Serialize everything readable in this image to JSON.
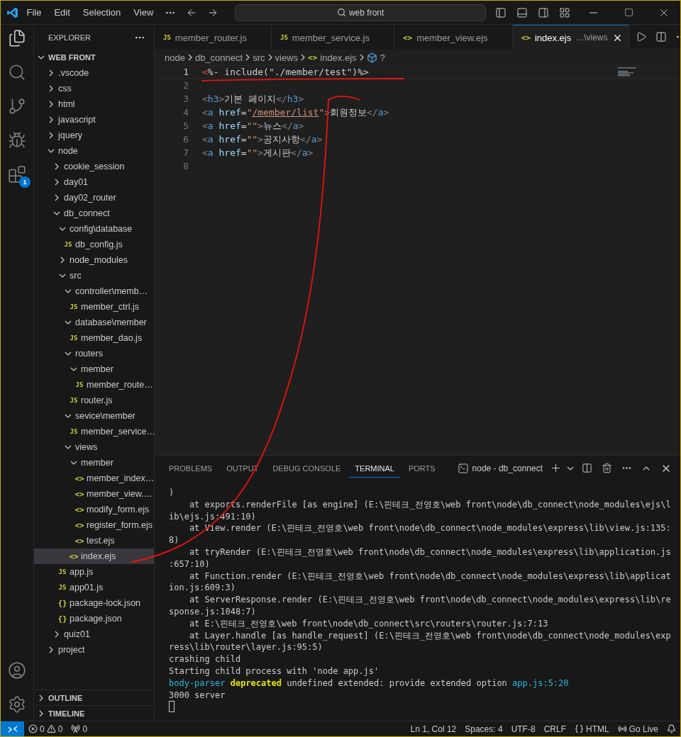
{
  "title_bar": {
    "menu": [
      "File",
      "Edit",
      "Selection",
      "View"
    ],
    "search": "web front"
  },
  "activity_bar": {
    "extensions_badge": "1"
  },
  "sidebar": {
    "title": "EXPLORER",
    "root": {
      "label": "WEB FRONT",
      "expanded": true
    },
    "tree": [
      {
        "label": ".vscode",
        "kind": "folder",
        "expanded": false,
        "selected": false
      },
      {
        "label": "css",
        "kind": "folder",
        "expanded": false,
        "selected": false
      },
      {
        "label": "html",
        "kind": "folder",
        "expanded": false,
        "selected": false
      },
      {
        "label": "javascript",
        "kind": "folder",
        "expanded": false,
        "selected": false
      },
      {
        "label": "jquery",
        "kind": "folder",
        "expanded": false,
        "selected": false
      },
      {
        "label": "node",
        "kind": "folder",
        "expanded": true,
        "selected": false,
        "children": [
          {
            "label": "cookie_session",
            "kind": "folder",
            "expanded": false,
            "selected": false
          },
          {
            "label": "day01",
            "kind": "folder",
            "expanded": false,
            "selected": false
          },
          {
            "label": "day02_router",
            "kind": "folder",
            "expanded": false,
            "selected": false
          },
          {
            "label": "db_connect",
            "kind": "folder",
            "expanded": true,
            "selected": false,
            "children": [
              {
                "label": "config\\database",
                "kind": "folder",
                "expanded": true,
                "selected": false,
                "children": [
                  {
                    "label": "db_config.js",
                    "kind": "file",
                    "icon": "JS",
                    "selected": false
                  }
                ]
              },
              {
                "label": "node_modules",
                "kind": "folder",
                "expanded": false,
                "selected": false
              },
              {
                "label": "src",
                "kind": "folder",
                "expanded": true,
                "selected": false,
                "children": [
                  {
                    "label": "controller\\memb…",
                    "kind": "folder",
                    "expanded": true,
                    "selected": false,
                    "children": [
                      {
                        "label": "member_ctrl.js",
                        "kind": "file",
                        "icon": "JS",
                        "selected": false
                      }
                    ]
                  },
                  {
                    "label": "database\\member",
                    "kind": "folder",
                    "expanded": true,
                    "selected": false,
                    "children": [
                      {
                        "label": "member_dao.js",
                        "kind": "file",
                        "icon": "JS",
                        "selected": false
                      }
                    ]
                  },
                  {
                    "label": "routers",
                    "kind": "folder",
                    "expanded": true,
                    "selected": false,
                    "children": [
                      {
                        "label": "member",
                        "kind": "folder",
                        "expanded": true,
                        "selected": false,
                        "children": [
                          {
                            "label": "member_route…",
                            "kind": "file",
                            "icon": "JS",
                            "selected": false
                          }
                        ]
                      },
                      {
                        "label": "router.js",
                        "kind": "file",
                        "icon": "JS",
                        "selected": false
                      }
                    ]
                  },
                  {
                    "label": "sevice\\member",
                    "kind": "folder",
                    "expanded": true,
                    "selected": false,
                    "children": [
                      {
                        "label": "member_service…",
                        "kind": "file",
                        "icon": "JS",
                        "selected": false
                      }
                    ]
                  },
                  {
                    "label": "views",
                    "kind": "folder",
                    "expanded": true,
                    "selected": false,
                    "children": [
                      {
                        "label": "member",
                        "kind": "folder",
                        "expanded": true,
                        "selected": false,
                        "children": [
                          {
                            "label": "member_index…",
                            "kind": "file",
                            "icon": "<>",
                            "selected": false
                          },
                          {
                            "label": "member_view.…",
                            "kind": "file",
                            "icon": "<>",
                            "selected": false
                          },
                          {
                            "label": "modify_form.ejs",
                            "kind": "file",
                            "icon": "<>",
                            "selected": false
                          },
                          {
                            "label": "register_form.ejs",
                            "kind": "file",
                            "icon": "<>",
                            "selected": false
                          },
                          {
                            "label": "test.ejs",
                            "kind": "file",
                            "icon": "<>",
                            "selected": false
                          }
                        ]
                      },
                      {
                        "label": "index.ejs",
                        "kind": "file",
                        "icon": "<>",
                        "selected": true
                      }
                    ]
                  }
                ]
              },
              {
                "label": "app.js",
                "kind": "file",
                "icon": "JS",
                "selected": false
              },
              {
                "label": "app01.js",
                "kind": "file",
                "icon": "JS",
                "selected": false
              },
              {
                "label": "package-lock.json",
                "kind": "file",
                "icon": "{}",
                "selected": false
              },
              {
                "label": "package.json",
                "kind": "file",
                "icon": "{}",
                "selected": false
              }
            ]
          },
          {
            "label": "quiz01",
            "kind": "folder",
            "expanded": false,
            "selected": false
          }
        ]
      },
      {
        "label": "project",
        "kind": "folder",
        "expanded": false,
        "selected": false
      }
    ],
    "sections": [
      {
        "label": "OUTLINE",
        "expanded": false
      },
      {
        "label": "TIMELINE",
        "expanded": false
      }
    ]
  },
  "tabs": [
    {
      "icon": "JS",
      "label": "member_router.js",
      "selected": false
    },
    {
      "icon": "JS",
      "label": "member_service.js",
      "selected": false
    },
    {
      "icon": "<>",
      "label": "member_view.ejs",
      "selected": false
    },
    {
      "icon": "<>",
      "label": "index.ejs",
      "description": "…\\views",
      "selected": true
    }
  ],
  "breadcrumbs": [
    {
      "kind": "folder",
      "label": "node"
    },
    {
      "kind": "folder",
      "label": "db_connect"
    },
    {
      "kind": "folder",
      "label": "src"
    },
    {
      "kind": "folder",
      "label": "views"
    },
    {
      "kind": "file",
      "icon": "<>",
      "label": "index.ejs"
    },
    {
      "kind": "symbol",
      "label": "?"
    }
  ],
  "editor": {
    "lines": [
      {
        "number": "1",
        "current": true,
        "tokens": [
          {
            "kind": "error",
            "text": "<"
          },
          {
            "kind": "text",
            "text": "%- include(\"./member/test\")%>"
          }
        ]
      },
      {
        "number": "2",
        "current": false
      },
      {
        "number": "3",
        "current": false,
        "tokens": [
          {
            "kind": "bracket",
            "text": "<"
          },
          {
            "kind": "tag",
            "text": "h3"
          },
          {
            "kind": "bracket",
            "text": ">"
          },
          {
            "kind": "text",
            "text": "기본 페이지"
          },
          {
            "kind": "bracket",
            "text": "</"
          },
          {
            "kind": "tag",
            "text": "h3"
          },
          {
            "kind": "bracket",
            "text": ">"
          }
        ]
      },
      {
        "number": "4",
        "current": false,
        "tokens": [
          {
            "kind": "bracket",
            "text": "<"
          },
          {
            "kind": "tag",
            "text": "a"
          },
          {
            "kind": "attr",
            "text": " href"
          },
          {
            "kind": "text",
            "text": "="
          },
          {
            "kind": "string",
            "text": "\""
          },
          {
            "kind": "link",
            "text": "/member/list"
          },
          {
            "kind": "string",
            "text": "\""
          },
          {
            "kind": "bracket",
            "text": ">"
          },
          {
            "kind": "text",
            "text": "회원정보"
          },
          {
            "kind": "bracket",
            "text": "</"
          },
          {
            "kind": "tag",
            "text": "a"
          },
          {
            "kind": "bracket",
            "text": ">"
          }
        ]
      },
      {
        "number": "5",
        "current": false,
        "tokens": [
          {
            "kind": "bracket",
            "text": "<"
          },
          {
            "kind": "tag",
            "text": "a"
          },
          {
            "kind": "attr",
            "text": " href"
          },
          {
            "kind": "text",
            "text": "="
          },
          {
            "kind": "string",
            "text": "\"\""
          },
          {
            "kind": "bracket",
            "text": ">"
          },
          {
            "kind": "text",
            "text": "뉴스"
          },
          {
            "kind": "bracket",
            "text": "</"
          },
          {
            "kind": "tag",
            "text": "a"
          },
          {
            "kind": "bracket",
            "text": ">"
          }
        ]
      },
      {
        "number": "6",
        "current": false,
        "tokens": [
          {
            "kind": "bracket",
            "text": "<"
          },
          {
            "kind": "tag",
            "text": "a"
          },
          {
            "kind": "attr",
            "text": " href"
          },
          {
            "kind": "text",
            "text": "="
          },
          {
            "kind": "string",
            "text": "\"\""
          },
          {
            "kind": "bracket",
            "text": ">"
          },
          {
            "kind": "text",
            "text": "공지사항"
          },
          {
            "kind": "bracket",
            "text": "</"
          },
          {
            "kind": "tag",
            "text": "a"
          },
          {
            "kind": "bracket",
            "text": ">"
          }
        ]
      },
      {
        "number": "7",
        "current": false,
        "tokens": [
          {
            "kind": "bracket",
            "text": "<"
          },
          {
            "kind": "tag",
            "text": "a"
          },
          {
            "kind": "attr",
            "text": " href"
          },
          {
            "kind": "text",
            "text": "="
          },
          {
            "kind": "string",
            "text": "\"\""
          },
          {
            "kind": "bracket",
            "text": ">"
          },
          {
            "kind": "text",
            "text": "게시판"
          },
          {
            "kind": "bracket",
            "text": "</"
          },
          {
            "kind": "tag",
            "text": "a"
          },
          {
            "kind": "bracket",
            "text": ">"
          }
        ]
      },
      {
        "number": "8",
        "current": false
      }
    ]
  },
  "panel": {
    "tabs": [
      {
        "label": "PROBLEMS",
        "selected": false
      },
      {
        "label": "OUTPUT",
        "selected": false
      },
      {
        "label": "DEBUG CONSOLE",
        "selected": false
      },
      {
        "label": "TERMINAL",
        "selected": true
      },
      {
        "label": "PORTS",
        "selected": false
      }
    ],
    "terminal_name": "node - db_connect",
    "lines": [
      {
        "kind": "plain",
        "text": ")"
      },
      {
        "kind": "plain",
        "text": "    at exports.renderFile [as engine] (E:\\핀테크_전영호\\web front\\node\\db_connect\\node_modules\\ejs\\l"
      },
      {
        "kind": "plain",
        "text": "ib\\ejs.js:491:10)"
      },
      {
        "kind": "plain",
        "text": "    at View.render (E:\\핀테크_전영호\\web front\\node\\db_connect\\node_modules\\express\\lib\\view.js:135:"
      },
      {
        "kind": "plain",
        "text": "8)"
      },
      {
        "kind": "plain",
        "text": "    at tryRender (E:\\핀테크_전영호\\web front\\node\\db_connect\\node_modules\\express\\lib\\application.js"
      },
      {
        "kind": "plain",
        "text": ":657:10)"
      },
      {
        "kind": "plain",
        "text": "    at Function.render (E:\\핀테크_전영호\\web front\\node\\db_connect\\node_modules\\express\\lib\\applicat"
      },
      {
        "kind": "plain",
        "text": "ion.js:609:3)"
      },
      {
        "kind": "plain",
        "text": "    at ServerResponse.render (E:\\핀테크_전영호\\web front\\node\\db_connect\\node_modules\\express\\lib\\re"
      },
      {
        "kind": "plain",
        "text": "sponse.js:1048:7)"
      },
      {
        "kind": "plain",
        "text": "    at E:\\핀테크_전영호\\web front\\node\\db_connect\\src\\routers\\router.js:7:13"
      },
      {
        "kind": "plain",
        "text": "    at Layer.handle [as handle_request] (E:\\핀테크_전영호\\web front\\node\\db_connect\\node_modules\\exp"
      },
      {
        "kind": "plain",
        "text": "ress\\lib\\router\\layer.js:95:5)"
      },
      {
        "kind": "plain",
        "text": "crashing child"
      },
      {
        "kind": "plain",
        "text": "Starting child process with 'node app.js'"
      },
      {
        "kind": "parts",
        "parts": [
          {
            "kind": "module",
            "text": "body-parser "
          },
          {
            "kind": "warning",
            "text": "deprecated"
          },
          {
            "kind": "plain",
            "text": " undefined extended: provide extended option"
          },
          {
            "kind": "location",
            "text": " app.js:5:20"
          }
        ]
      },
      {
        "kind": "plain",
        "text": "3000 server"
      }
    ]
  },
  "status_bar": {
    "errors": "0",
    "warnings": "0",
    "ports": "0",
    "right": [
      {
        "kind": "text",
        "label": "Ln 1, Col 12"
      },
      {
        "kind": "text",
        "label": "Spaces: 4"
      },
      {
        "kind": "text",
        "label": "UTF-8"
      },
      {
        "kind": "text",
        "label": "CRLF"
      },
      {
        "kind": "language",
        "label": "HTML"
      },
      {
        "kind": "live",
        "label": "Go Live"
      }
    ]
  }
}
